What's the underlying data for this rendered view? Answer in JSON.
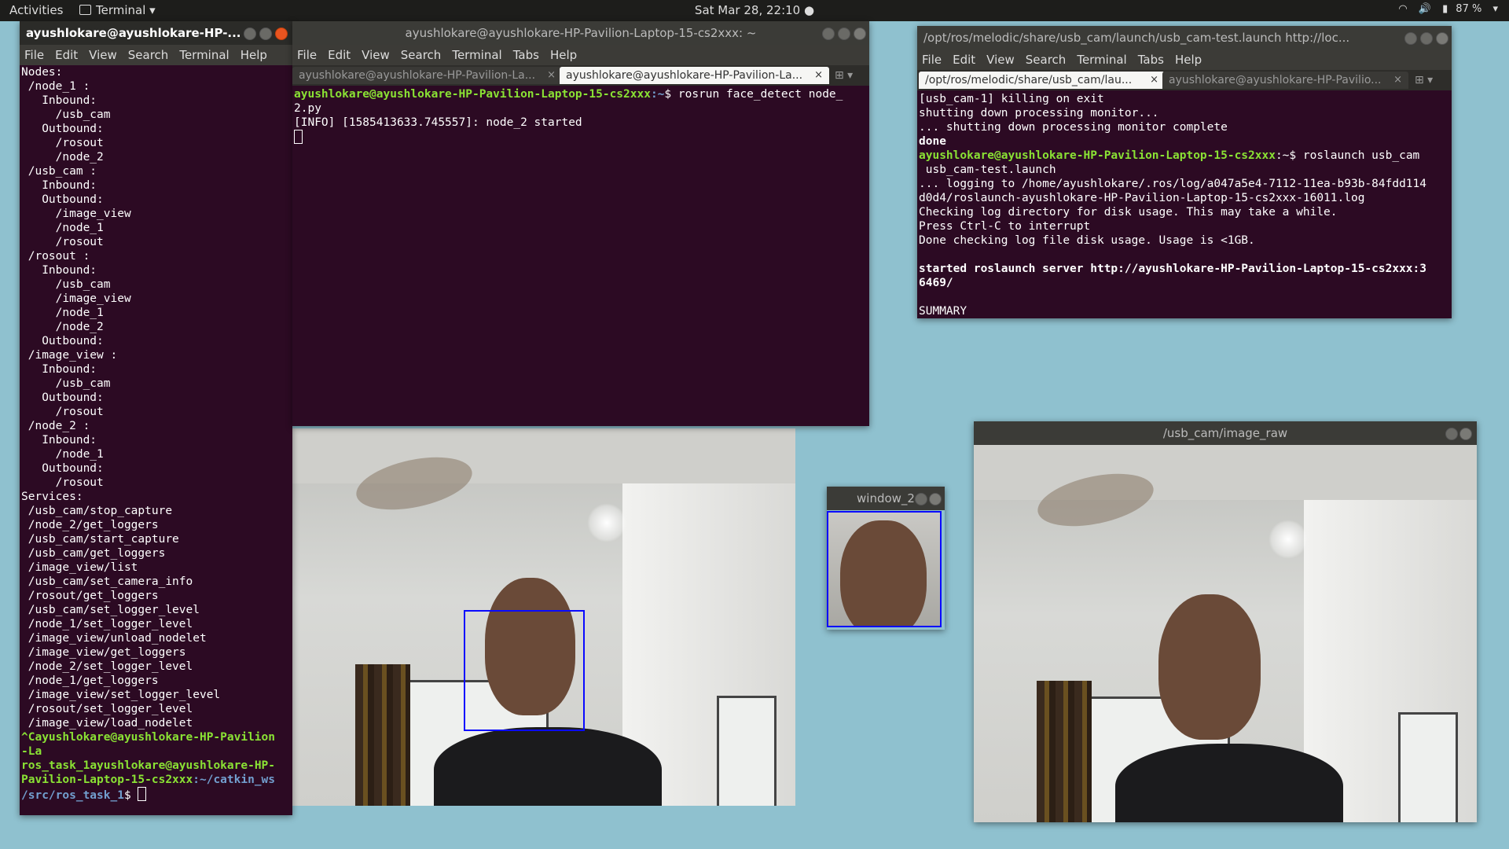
{
  "topbar": {
    "activities": "Activities",
    "app": "Terminal",
    "clock": "Sat Mar 28, 22:10",
    "battery": "87 %"
  },
  "win_left": {
    "title": "ayushlokare@ayushlokare-HP-...",
    "menu": [
      "File",
      "Edit",
      "View",
      "Search",
      "Terminal",
      "Help"
    ],
    "lines": [
      "Nodes:",
      " /node_1 :",
      "   Inbound:",
      "     /usb_cam",
      "   Outbound:",
      "     /rosout",
      "     /node_2",
      " /usb_cam :",
      "   Inbound:",
      "   Outbound:",
      "     /image_view",
      "     /node_1",
      "     /rosout",
      " /rosout :",
      "   Inbound:",
      "     /usb_cam",
      "     /image_view",
      "     /node_1",
      "     /node_2",
      "   Outbound:",
      " /image_view :",
      "   Inbound:",
      "     /usb_cam",
      "   Outbound:",
      "     /rosout",
      " /node_2 :",
      "   Inbound:",
      "     /node_1",
      "   Outbound:",
      "     /rosout",
      "Services:",
      " /usb_cam/stop_capture",
      " /node_2/get_loggers",
      " /usb_cam/start_capture",
      " /usb_cam/get_loggers",
      " /image_view/list",
      " /usb_cam/set_camera_info",
      " /rosout/get_loggers",
      " /usb_cam/set_logger_level",
      " /node_1/set_logger_level",
      " /image_view/unload_nodelet",
      " /image_view/get_loggers",
      " /node_2/set_logger_level",
      " /node_1/get_loggers",
      " /image_view/set_logger_level",
      " /rosout/set_logger_level",
      " /image_view/load_nodelet"
    ],
    "prompt1": "^Cayushlokare@ayushlokare-HP-Pavilion",
    "prompt1b": "-La",
    "prompt2a": "ros_task_1",
    "prompt2b": "ayushlokare@ayushlokare-HP-",
    "prompt3": "Pavilion-Laptop-15-cs2xxx",
    "prompt3b": ":~/catkin_ws",
    "prompt4": "/src/ros_task_1",
    "prompt4b": "$ "
  },
  "win_mid": {
    "title": "ayushlokare@ayushlokare-HP-Pavilion-Laptop-15-cs2xxx: ~",
    "menu": [
      "File",
      "Edit",
      "View",
      "Search",
      "Terminal",
      "Tabs",
      "Help"
    ],
    "tab1": "ayushlokare@ayushlokare-HP-Pavilion-La...",
    "tab2": "ayushlokare@ayushlokare-HP-Pavilion-La...",
    "prompt_user": "ayushlokare@ayushlokare-HP-Pavilion-Laptop-15-cs2xxx",
    "prompt_path": ":~",
    "command": "$ rosrun face_detect node_",
    "command2": "2.py",
    "info": "[INFO] [1585413633.745557]: node_2 started"
  },
  "win_right": {
    "title": "/opt/ros/melodic/share/usb_cam/launch/usb_cam-test.launch http://loc...",
    "menu": [
      "File",
      "Edit",
      "View",
      "Search",
      "Terminal",
      "Tabs",
      "Help"
    ],
    "tab1": "/opt/ros/melodic/share/usb_cam/lau...",
    "tab2": "ayushlokare@ayushlokare-HP-Pavilio...",
    "l1": "[usb_cam-1] killing on exit",
    "l2": "shutting down processing monitor...",
    "l3": "... shutting down processing monitor complete",
    "l4": "done",
    "l5_user": "ayushlokare@ayushlokare-HP-Pavilion-Laptop-15-cs2xxx",
    "l5_rest": ":~$ roslaunch usb_cam",
    "l6": " usb_cam-test.launch",
    "l7": "... logging to /home/ayushlokare/.ros/log/a047a5e4-7112-11ea-b93b-84fdd114",
    "l8": "d0d4/roslaunch-ayushlokare-HP-Pavilion-Laptop-15-cs2xxx-16011.log",
    "l9": "Checking log directory for disk usage. This may take a while.",
    "l10": "Press Ctrl-C to interrupt",
    "l11": "Done checking log file disk usage. Usage is <1GB.",
    "l12": "started roslaunch server http://ayushlokare-HP-Pavilion-Laptop-15-cs2xxx:3",
    "l13": "6469/",
    "l14": "SUMMARY"
  },
  "win_window2": {
    "title": "window_2"
  },
  "win_image_raw": {
    "title": "/usb_cam/image_raw"
  }
}
